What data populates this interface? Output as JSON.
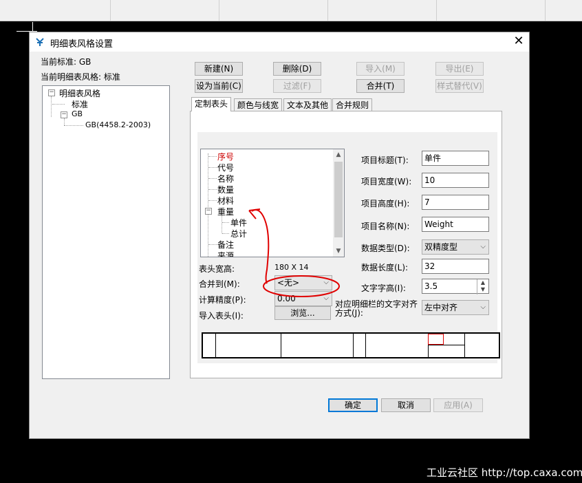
{
  "dialog": {
    "title": "明细表风格设置",
    "current_standard": "当前标准: GB",
    "current_style": "当前明细表风格: 标准"
  },
  "left_tree": {
    "root": "明细表风格",
    "items": [
      "标准",
      "GB",
      "GB(4458.2-2003)"
    ]
  },
  "toolbar": {
    "new": "新建(N)",
    "delete": "删除(D)",
    "import": "导入(M)",
    "export": "导出(E)",
    "set_current": "设为当前(C)",
    "filter": "过滤(F)",
    "merge": "合并(T)",
    "replace_style": "样式替代(V)"
  },
  "tabs": [
    "定制表头",
    "颜色与线宽",
    "文本及其他",
    "合并规则"
  ],
  "header_list": {
    "items": [
      "序号",
      "代号",
      "名称",
      "数量",
      "材料",
      "重量",
      "单件",
      "总计",
      "备注",
      "来源"
    ],
    "selected": "序号"
  },
  "header_size": {
    "label": "表头宽高:",
    "value": "180 X 14"
  },
  "merge_to": {
    "label": "合并到(M):",
    "value": "<无>"
  },
  "precision": {
    "label": "计算精度(P):",
    "value": "0.00"
  },
  "import_header": {
    "label": "导入表头(I):",
    "button": "浏览..."
  },
  "props": {
    "title": {
      "label": "项目标题(T):",
      "value": "单件"
    },
    "width": {
      "label": "项目宽度(W):",
      "value": "10"
    },
    "height": {
      "label": "项目高度(H):",
      "value": "7"
    },
    "name": {
      "label": "项目名称(N):",
      "value": "Weight"
    },
    "data_type": {
      "label": "数据类型(D):",
      "value": "双精度型"
    },
    "data_length": {
      "label": "数据长度(L):",
      "value": "32"
    },
    "text_height": {
      "label": "文字字高(I):",
      "value": "3.5"
    },
    "align": {
      "label": "对应明细栏的文字对齐方式(J):",
      "value": "左中对齐"
    }
  },
  "footer": {
    "ok": "确定",
    "cancel": "取消",
    "apply": "应用(A)"
  },
  "watermark": "工业云社区 http://top.caxa.com/",
  "colors": {
    "accent": "#0078d7",
    "selected_text": "#cc0000",
    "annotation": "#e00000"
  }
}
